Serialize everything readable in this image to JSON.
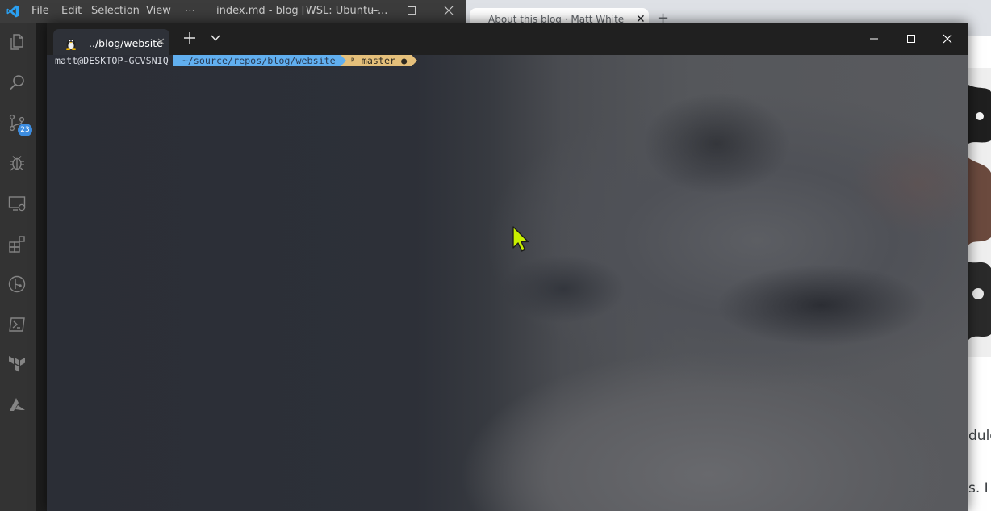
{
  "vscode": {
    "menu": [
      "File",
      "Edit",
      "Selection",
      "View",
      "⋯"
    ],
    "window_title": "index.md - blog [WSL: Ubuntu-...",
    "source_control_badge": "23",
    "activity_icons": [
      "explorer-icon",
      "search-icon",
      "source-control-icon",
      "debug-icon",
      "remote-explorer-icon",
      "extensions-icon",
      "gitlens-icon",
      "powershell-icon",
      "terraform-icon",
      "azure-icon"
    ]
  },
  "browser": {
    "tab_title": "About this blog · Matt White's Bl",
    "tab_close": "✕",
    "new_tab": "+",
    "partial_text_1": "dulge",
    "partial_text_2": "s. I w"
  },
  "terminal": {
    "tab_title": "../blog/website",
    "tab_close": "✕",
    "prompt": {
      "user_host": "matt@DESKTOP-GCVSNIQ",
      "path": "~/source/repos/blog/website",
      "git_branch": "ᵖ master ●"
    }
  },
  "colors": {
    "prompt_path_bg": "#61afef",
    "prompt_git_bg": "#e5c07b",
    "cursor": "#c8f000",
    "vscode_accent": "#0078d4"
  }
}
